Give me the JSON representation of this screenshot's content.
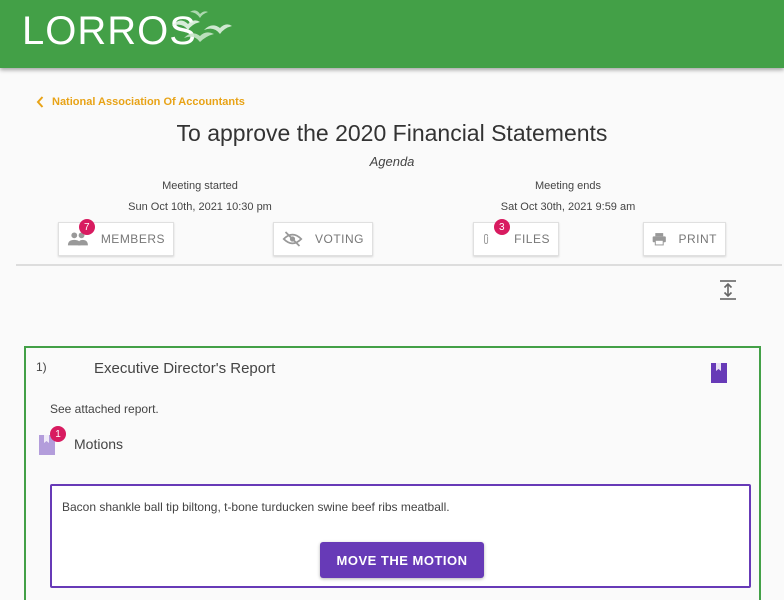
{
  "header": {
    "logo_text": "LORROS",
    "brand_color": "#43a047"
  },
  "breadcrumb": {
    "back_label": "National Association Of Accountants",
    "color": "#e8a317"
  },
  "meeting": {
    "title": "To approve the 2020 Financial Statements",
    "subtitle": "Agenda",
    "started_label": "Meeting started",
    "started_value": "Sun Oct 10th, 2021 10:30 pm",
    "ends_label": "Meeting ends",
    "ends_value": "Sat Oct 30th, 2021 9:59 am"
  },
  "tabs": [
    {
      "label": "MEMBERS",
      "icon": "people-icon",
      "badge": "7"
    },
    {
      "label": "VOTING",
      "icon": "eye-off-icon"
    },
    {
      "label": "FILES",
      "icon": "paperclip-icon",
      "badge": "3"
    },
    {
      "label": "PRINT",
      "icon": "printer-icon"
    }
  ],
  "agenda_item": {
    "number": "1)",
    "title": "Executive Director's Report",
    "description": "See attached report.",
    "motions_label": "Motions",
    "motions_badge": "1",
    "motion": {
      "text": "Bacon shankle ball tip biltong, t-bone turducken swine beef ribs meatball.",
      "button_label": "MOVE THE MOTION"
    }
  },
  "colors": {
    "accent_purple": "#673ab7",
    "badge_pink": "#d81b60",
    "card_border": "#43a047"
  }
}
